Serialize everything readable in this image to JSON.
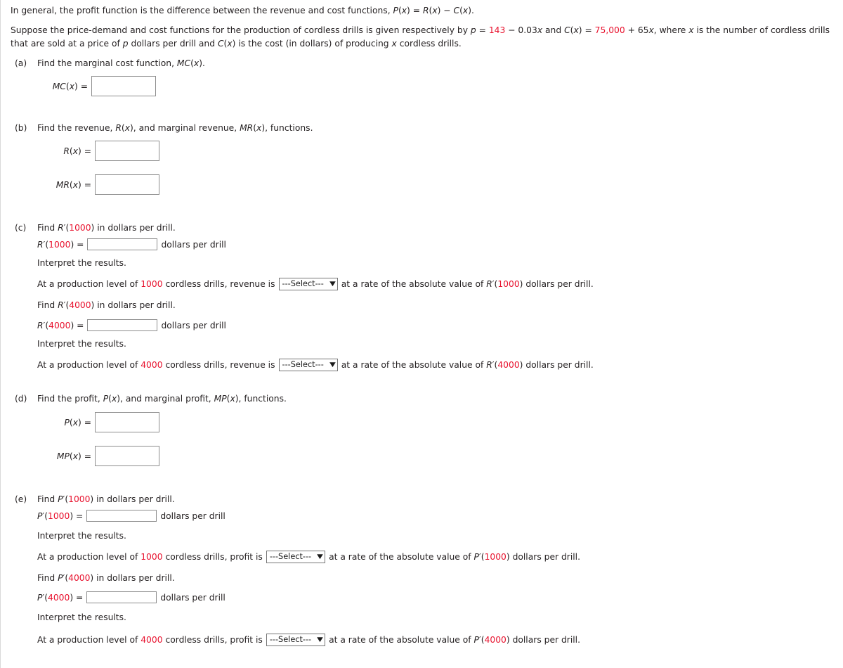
{
  "intro": {
    "line1_a": "In general, the profit function is the difference between the revenue and cost functions, ",
    "line1_px": "P",
    "line1_b": "(",
    "line1_x1": "x",
    "line1_c": ") = ",
    "line1_rx": "R",
    "line1_d": "(",
    "line1_x2": "x",
    "line1_e": ") − ",
    "line1_cx": "C",
    "line1_f": "(",
    "line1_x3": "x",
    "line1_g": ").",
    "line2_a": "Suppose the price-demand and cost functions for the production of cordless drills is given respectively by ",
    "line2_p": "p",
    "line2_b": " = ",
    "line2_price_const": "143",
    "line2_c": " − 0.03",
    "line2_x1": "x",
    "line2_d": " and ",
    "line2_C": "C",
    "line2_e": "(",
    "line2_x2": "x",
    "line2_f": ") = ",
    "line2_cost_const": "75,000",
    "line2_g": " + 65",
    "line2_x3": "x",
    "line2_h": ", where ",
    "line2_x4": "x",
    "line2_i": " is the number of cordless drills",
    "line3": "that are sold at a price of ",
    "line3_p": "p",
    "line3_b": " dollars per drill and ",
    "line3_C": "C",
    "line3_c": "(",
    "line3_x1": "x",
    "line3_d": ") is the cost (in dollars) of producing ",
    "line3_x2": "x",
    "line3_e": " cordless drills."
  },
  "parts": {
    "a": {
      "label": "(a)",
      "prompt_a": "Find the marginal cost function, ",
      "prompt_fn": "MC",
      "prompt_b": "(",
      "prompt_x": "x",
      "prompt_c": ").",
      "field_label_fn": "MC",
      "field_label_b": "(",
      "field_label_x": "x",
      "field_label_c": ") =",
      "field_value": "",
      "field_placeholder": ""
    },
    "b": {
      "label": "(b)",
      "prompt_a": "Find the revenue, ",
      "prompt_fn1": "R",
      "prompt_b": "(",
      "prompt_x1": "x",
      "prompt_c": "), and marginal revenue, ",
      "prompt_fn2": "MR",
      "prompt_d": "(",
      "prompt_x2": "x",
      "prompt_e": "), functions.",
      "row1_fn": "R",
      "row1_b": "(",
      "row1_x": "x",
      "row1_c": ")  =",
      "row1_value": "",
      "row2_fn": "MR",
      "row2_b": "(",
      "row2_x": "x",
      "row2_c": ")  =",
      "row2_value": ""
    },
    "c": {
      "label": "(c)",
      "prompt_a": "Find ",
      "prompt_fn": "R",
      "prompt_prime": "′(",
      "prompt_num": "1000",
      "prompt_b": ") in dollars per drill.",
      "field1_fn": "R",
      "field1_prime": "′(",
      "field1_num": "1000",
      "field1_b": ") =",
      "field1_value": "",
      "field1_unit": "dollars per drill",
      "interpret": "Interpret the results.",
      "sent1_a": "At a production level of ",
      "sent1_num": "1000",
      "sent1_b": " cordless drills, revenue is",
      "sent1_select": "---Select---",
      "sent1_c": "at a rate of the absolute value of ",
      "sent1_fn": "R",
      "sent1_prime": "′(",
      "sent1_num2": "1000",
      "sent1_d": ") dollars per drill.",
      "prompt2_a": "Find ",
      "prompt2_fn": "R",
      "prompt2_prime": "′(",
      "prompt2_num": "4000",
      "prompt2_b": ") in dollars per drill.",
      "field2_fn": "R",
      "field2_prime": "′(",
      "field2_num": "4000",
      "field2_b": ") =",
      "field2_value": "",
      "field2_unit": "dollars per drill",
      "interpret2": "Interpret the results.",
      "sent2_a": "At a production level of ",
      "sent2_num": "4000",
      "sent2_b": " cordless drills, revenue is",
      "sent2_select": "---Select---",
      "sent2_c": "at a rate of the absolute value of ",
      "sent2_fn": "R",
      "sent2_prime": "′(",
      "sent2_num2": "4000",
      "sent2_d": ") dollars per drill."
    },
    "d": {
      "label": "(d)",
      "prompt_a": "Find the profit, ",
      "prompt_fn1": "P",
      "prompt_b": "(",
      "prompt_x1": "x",
      "prompt_c": "), and marginal profit, ",
      "prompt_fn2": "MP",
      "prompt_d": "(",
      "prompt_x2": "x",
      "prompt_e": "), functions.",
      "row1_fn": "P",
      "row1_b": "(",
      "row1_x": "x",
      "row1_c": ")  =",
      "row1_value": "",
      "row2_fn": "MP",
      "row2_b": "(",
      "row2_x": "x",
      "row2_c": ")  =",
      "row2_value": ""
    },
    "e": {
      "label": "(e)",
      "prompt_a": "Find ",
      "prompt_fn": "P",
      "prompt_prime": "′(",
      "prompt_num": "1000",
      "prompt_b": ") in dollars per drill.",
      "field1_fn": "P",
      "field1_prime": "′(",
      "field1_num": "1000",
      "field1_b": ") =",
      "field1_value": "",
      "field1_unit": "dollars per drill",
      "interpret": "Interpret the results.",
      "sent1_a": "At a production level of ",
      "sent1_num": "1000",
      "sent1_b": " cordless drills, profit is",
      "sent1_select": "---Select---",
      "sent1_c": "at a rate of the absolute value of ",
      "sent1_fn": "P",
      "sent1_prime": "′(",
      "sent1_num2": "1000",
      "sent1_d": ") dollars per drill.",
      "prompt2_a": "Find ",
      "prompt2_fn": "P",
      "prompt2_prime": "′(",
      "prompt2_num": "4000",
      "prompt2_b": ") in dollars per drill.",
      "field2_fn": "P",
      "field2_prime": "′(",
      "field2_num": "4000",
      "field2_b": ") =",
      "field2_value": "",
      "field2_unit": "dollars per drill",
      "interpret2": "Interpret the results.",
      "sent2_a": "At a production level of ",
      "sent2_num": "4000",
      "sent2_b": " cordless drills, profit is",
      "sent2_select": "---Select---",
      "sent2_c": "at a rate of the absolute value of ",
      "sent2_fn": "P",
      "sent2_prime": "′(",
      "sent2_num2": "4000",
      "sent2_d": ") dollars per drill."
    }
  },
  "icons": {
    "caret": "▼"
  },
  "colors": {
    "accent_red": "#e8112d",
    "text": "#231f20",
    "box_border": "#8d8d8d"
  }
}
